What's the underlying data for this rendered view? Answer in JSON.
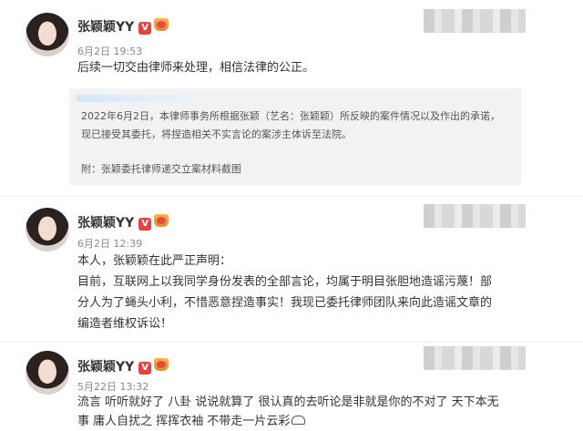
{
  "posts": [
    {
      "author": "张颖颖YY",
      "time": "6月2日 19:53",
      "text": "后续一切交由律师来处理，相信法律的公正。",
      "quote": {
        "line1": "2022年6月2日，本律师事务所根据张颖（艺名：张颖颖）所反映的案件情况以及作出的承诺，",
        "line2": "现已接受其委托，将捏造相关不实言论的案涉主体诉至法院。",
        "line3": "附：张颖委托律师递交立案材料截图"
      }
    },
    {
      "author": "张颖颖YY",
      "time": "6月2日 12:39",
      "lines": [
        "本人，张颖颖在此严正声明：",
        "目前，互联网上以我同学身份发表的全部言论，均属于明目张胆地造谣污蔑！部",
        "分人为了蝇头小利，不惜恶意捏造事实！我现已委托律师团队来向此造谣文章的",
        "编造者维权诉讼！"
      ]
    },
    {
      "author": "张颖颖YY",
      "time": "5月22日 13:32",
      "lines": [
        "流言 听听就好了 八卦 说说就算了 很认真的去听论是非就是你的不对了 天下本无",
        "事 庸人自扰之 挥挥衣袖 不带走一片云彩"
      ]
    }
  ],
  "badges": {
    "verified": "V"
  },
  "colors": {
    "verified": "#e8413e",
    "quote_bg": "#f2f2f2"
  }
}
